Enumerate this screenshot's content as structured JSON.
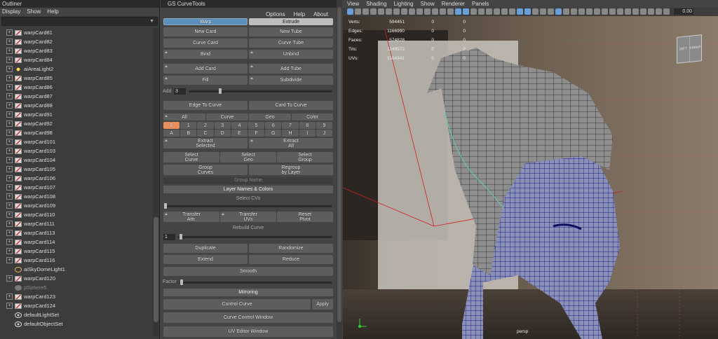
{
  "outliner": {
    "title": "Outliner",
    "menu": [
      "Display",
      "Show",
      "Help"
    ],
    "items": [
      {
        "label": "warpCard81",
        "icon": "card",
        "exp": true
      },
      {
        "label": "warpCard82",
        "icon": "card",
        "exp": true
      },
      {
        "label": "warpCard83",
        "icon": "card",
        "exp": true
      },
      {
        "label": "warpCard84",
        "icon": "card",
        "exp": true
      },
      {
        "label": "aiAreaLight2",
        "icon": "light",
        "exp": true
      },
      {
        "label": "warpCard85",
        "icon": "card",
        "exp": true
      },
      {
        "label": "warpCard86",
        "icon": "card",
        "exp": true
      },
      {
        "label": "warpCard87",
        "icon": "card",
        "exp": true
      },
      {
        "label": "warpCard88",
        "icon": "card",
        "exp": true
      },
      {
        "label": "warpCard91",
        "icon": "card",
        "exp": true
      },
      {
        "label": "warpCard92",
        "icon": "card",
        "exp": true
      },
      {
        "label": "warpCard98",
        "icon": "card",
        "exp": true
      },
      {
        "label": "warpCard101",
        "icon": "card",
        "exp": true
      },
      {
        "label": "warpCard103",
        "icon": "card",
        "exp": true
      },
      {
        "label": "warpCard104",
        "icon": "card",
        "exp": true
      },
      {
        "label": "warpCard105",
        "icon": "card",
        "exp": true
      },
      {
        "label": "warpCard106",
        "icon": "card",
        "exp": true
      },
      {
        "label": "warpCard107",
        "icon": "card",
        "exp": true
      },
      {
        "label": "warpCard108",
        "icon": "card",
        "exp": true
      },
      {
        "label": "warpCard109",
        "icon": "card",
        "exp": true
      },
      {
        "label": "warpCard110",
        "icon": "card",
        "exp": true
      },
      {
        "label": "warpCard111",
        "icon": "card",
        "exp": true
      },
      {
        "label": "warpCard113",
        "icon": "card",
        "exp": true
      },
      {
        "label": "warpCard114",
        "icon": "card",
        "exp": true
      },
      {
        "label": "warpCard115",
        "icon": "card",
        "exp": true
      },
      {
        "label": "warpCard116",
        "icon": "card",
        "exp": true
      },
      {
        "label": "aiSkyDomeLight1",
        "icon": "dome",
        "exp": false
      },
      {
        "label": "warpCard120",
        "icon": "card",
        "exp": true
      },
      {
        "label": "pSphere5",
        "icon": "sphere",
        "exp": false,
        "dim": true
      },
      {
        "label": "warpCard123",
        "icon": "card",
        "exp": true
      },
      {
        "label": "warpCard124",
        "icon": "card",
        "exp": true
      },
      {
        "label": "defaultLightSet",
        "icon": "set",
        "exp": false
      },
      {
        "label": "defaultObjectSet",
        "icon": "set",
        "exp": false
      }
    ]
  },
  "gs": {
    "title": "GS CurveTools",
    "menu": [
      "Options",
      "Help",
      "About"
    ],
    "warp": "Warp",
    "extrude": "Extrude",
    "new_card": "New Card",
    "new_tube": "New Tube",
    "curve_card": "Curve Card",
    "curve_tube": "Curve Tube",
    "bind": "Bind",
    "unbind": "Unbind",
    "add_card": "Add Card",
    "add_tube": "Add Tube",
    "fill": "Fill",
    "subdivide": "Subdivide",
    "add_label": "Add",
    "add_value": "3",
    "edge_to_curve": "Edge To Curve",
    "card_to_curve": "Card To Curve",
    "filters": [
      "All",
      "Curve",
      "Geo",
      "Color"
    ],
    "numbers": [
      "0",
      "1",
      "2",
      "3",
      "4",
      "5",
      "6",
      "7",
      "8",
      "9"
    ],
    "letters": [
      "A",
      "B",
      "C",
      "D",
      "E",
      "F",
      "G",
      "H",
      "I",
      "J"
    ],
    "extract_selected": "Extract\nSelected",
    "extract_all": "Extract\nAll",
    "select_curve": "Select\nCurve",
    "select_geo": "Select\nGeo",
    "select_group": "Select\nGroup",
    "group_curves": "Group\nCurves",
    "regroup": "Regroup\nby Layer",
    "group_name": "Group Name",
    "layer_names": "Layer Names & Colors",
    "select_cvs": "Select CVs",
    "transfer_attr": "Transfer\nAttr.",
    "transfer_uvs": "Transfer\nUVs",
    "reset_pivot": "Reset\nPivot",
    "rebuild_curve": "Rebuild Curve",
    "rebuild_value": "1",
    "duplicate": "Duplicate",
    "randomize": "Randomize",
    "extend": "Extend",
    "reduce": "Reduce",
    "smooth": "Smooth",
    "factor_label": "Factor",
    "mirroring": "Mirroring",
    "control_curve": "Control Curve",
    "apply": "Apply",
    "curve_control_window": "Curve Control Window",
    "uv_editor_window": "UV Editor Window"
  },
  "viewport": {
    "menu": [
      "View",
      "Shading",
      "Lighting",
      "Show",
      "Renderer",
      "Panels"
    ],
    "exposure": "0.00",
    "stats": [
      {
        "label": "Verts:",
        "v1": "594451",
        "v2": "0",
        "v3": "0"
      },
      {
        "label": "Edges:",
        "v1": "1166990",
        "v2": "0",
        "v3": "0"
      },
      {
        "label": "Faces:",
        "v1": "574828",
        "v2": "0",
        "v3": "0"
      },
      {
        "label": "Tris:",
        "v1": "1149572",
        "v2": "0",
        "v3": "0"
      },
      {
        "label": "UVs:",
        "v1": "1184341",
        "v2": "0",
        "v3": "0"
      }
    ],
    "camera": "persp",
    "cube_left": "LEFT",
    "cube_front": "FRONT"
  }
}
